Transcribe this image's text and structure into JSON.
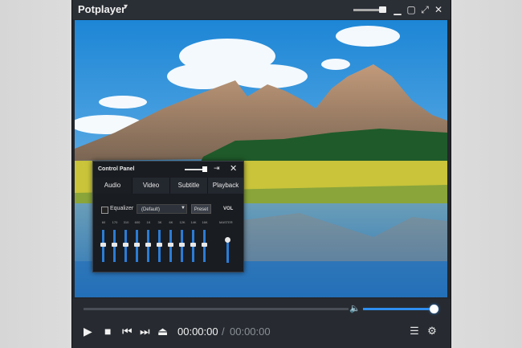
{
  "window": {
    "title": "Potplayer",
    "title_caret_icon": "caret-down",
    "buttons": [
      "minimize-icon",
      "maximize-icon",
      "fullscreen-icon",
      "close-icon"
    ]
  },
  "control_panel": {
    "title": "Control Panel",
    "tabs": [
      {
        "label": "Audio",
        "active": true
      },
      {
        "label": "Video",
        "active": false
      },
      {
        "label": "Subtitle",
        "active": false
      },
      {
        "label": "Playback",
        "active": false
      }
    ],
    "equalizer_label": "Equalizer",
    "preset_select_value": "(Default)",
    "preset_button": "Preset",
    "vol_label": "VOL",
    "bands": [
      "60",
      "170",
      "310",
      "600",
      "1K",
      "3K",
      "6K",
      "12K",
      "14K",
      "16K"
    ],
    "master_label": "MASTER"
  },
  "playback": {
    "current_time": "00:00:00",
    "separator": "/",
    "total_time": "00:00:00",
    "volume_fraction": 0.93
  },
  "colors": {
    "accent": "#2f8ef0",
    "window_bg": "#23272d"
  }
}
